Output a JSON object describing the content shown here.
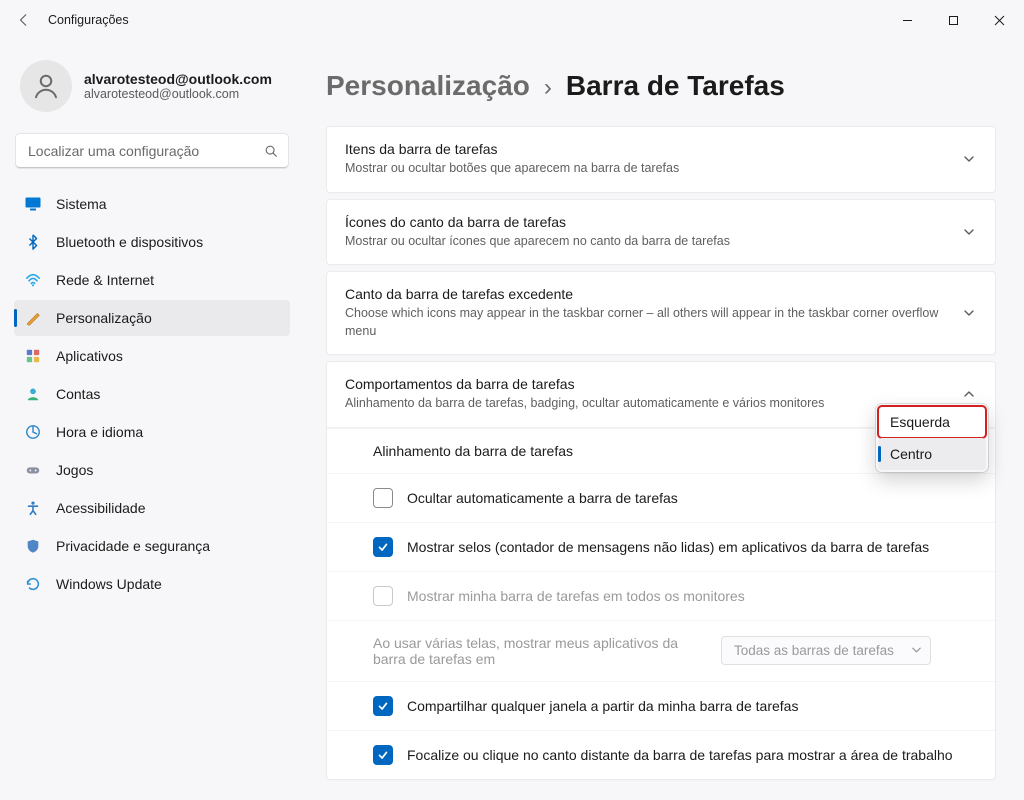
{
  "window_title": "Configurações",
  "profile": {
    "name": "alvarotesteod@outlook.com",
    "email": "alvarotesteod@outlook.com"
  },
  "search": {
    "placeholder": "Localizar uma configuração"
  },
  "nav": [
    {
      "label": "Sistema"
    },
    {
      "label": "Bluetooth e dispositivos"
    },
    {
      "label": "Rede & Internet"
    },
    {
      "label": "Personalização"
    },
    {
      "label": "Aplicativos"
    },
    {
      "label": "Contas"
    },
    {
      "label": "Hora e idioma"
    },
    {
      "label": "Jogos"
    },
    {
      "label": "Acessibilidade"
    },
    {
      "label": "Privacidade e segurança"
    },
    {
      "label": "Windows Update"
    }
  ],
  "breadcrumb": {
    "parent": "Personalização",
    "sep": "›",
    "current": "Barra de Tarefas"
  },
  "cards": {
    "items": {
      "title": "Itens da barra de tarefas",
      "sub": "Mostrar ou ocultar botões que aparecem na barra de tarefas"
    },
    "corner": {
      "title": "Ícones do canto da barra de tarefas",
      "sub": "Mostrar ou ocultar ícones que aparecem no canto da barra de tarefas"
    },
    "overflow": {
      "title": "Canto da barra de tarefas excedente",
      "sub": "Choose which icons may appear in the taskbar corner – all others will appear in the taskbar corner overflow menu"
    },
    "behaviors": {
      "title": "Comportamentos da barra de tarefas",
      "sub": "Alinhamento da barra de tarefas, badging, ocultar automaticamente e vários monitores"
    }
  },
  "behaviors": {
    "alignment_label": "Alinhamento da barra de tarefas",
    "auto_hide": "Ocultar automaticamente a barra de tarefas",
    "badges": "Mostrar selos (contador de mensagens não lidas) em aplicativos da barra de tarefas",
    "all_monitors": "Mostrar minha barra de tarefas em todos os monitores",
    "multi_text": "Ao usar várias telas, mostrar meus aplicativos da barra de tarefas em",
    "multi_select": "Todas as barras de tarefas",
    "share_any": "Compartilhar qualquer janela a partir da minha barra de tarefas",
    "peek": "Focalize ou clique no canto distante da barra de tarefas para mostrar a área de trabalho"
  },
  "dropdown": {
    "option0": "Esquerda",
    "option1": "Centro"
  }
}
